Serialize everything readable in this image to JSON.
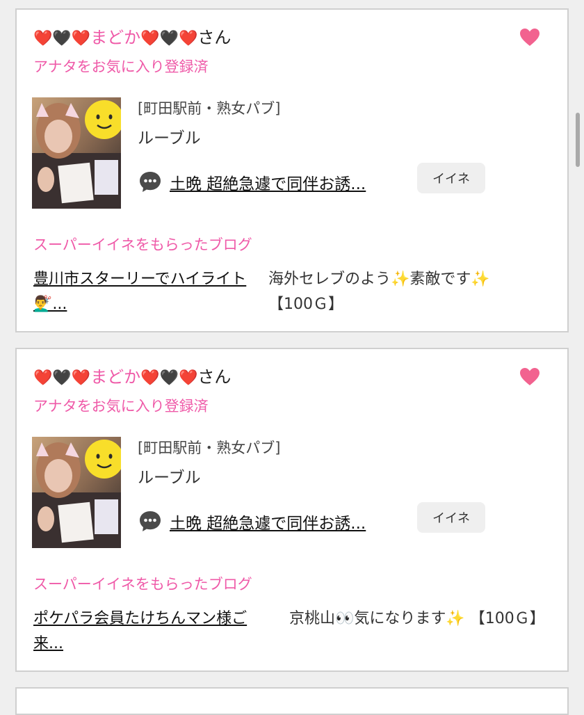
{
  "cards": [
    {
      "name_prefix_hearts": "❤️🖤❤️",
      "name_text": "まどか",
      "name_suffix_hearts": "❤️🖤❤️",
      "name_suffix": "さん",
      "favorite_status": "アナタをお気に入り登録済",
      "shop_area": "[町田駅前・熟女パブ]",
      "shop_name": "ルーブル",
      "message_link": "土晩 超絶急遽で同伴お誘...",
      "iine_label": "イイネ",
      "super_iine_label": "スーパーイイネをもらったブログ",
      "blog_title": "豊川市スターリーでハイライト💇‍♂️...",
      "blog_comment": "海外セレブのよう✨素敵です✨【100Ｇ】"
    },
    {
      "name_prefix_hearts": "❤️🖤❤️",
      "name_text": "まどか",
      "name_suffix_hearts": "❤️🖤❤️",
      "name_suffix": "さん",
      "favorite_status": "アナタをお気に入り登録済",
      "shop_area": "[町田駅前・熟女パブ]",
      "shop_name": "ルーブル",
      "message_link": "土晩 超絶急遽で同伴お誘...",
      "iine_label": "イイネ",
      "super_iine_label": "スーパーイイネをもらったブログ",
      "blog_title": "ポケパラ会員たけちんマン様ご来...",
      "blog_comment": "京桃山👀気になります✨ 【100Ｇ】"
    }
  ],
  "colors": {
    "accent_pink": "#ef5aa8",
    "favorite_heart": "#f2628f"
  },
  "icons": {
    "favorite": "heart-icon",
    "message": "chat-bubble-icon"
  }
}
